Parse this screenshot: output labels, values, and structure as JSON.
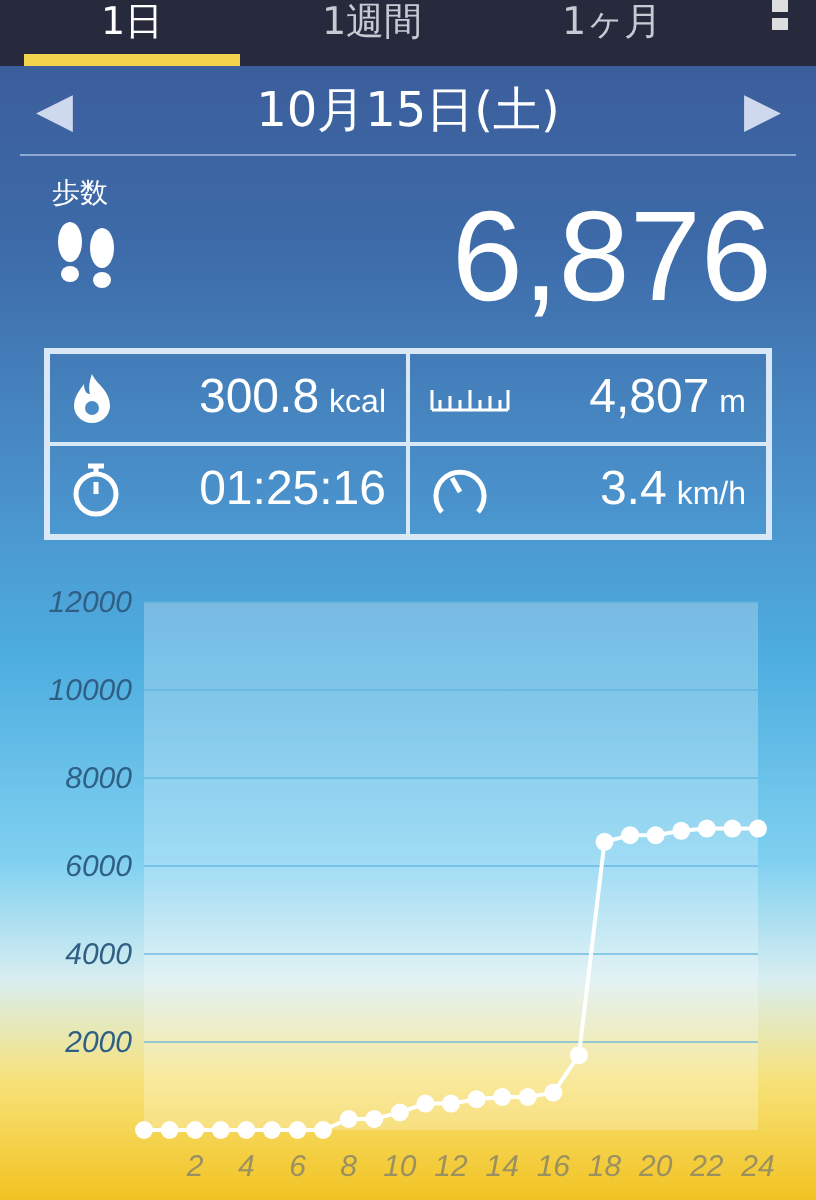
{
  "tabs": [
    {
      "label": "1日",
      "selected": true
    },
    {
      "label": "1週間",
      "selected": false
    },
    {
      "label": "1ヶ月",
      "selected": false
    }
  ],
  "date_nav": {
    "prev": "◀",
    "date": "10月15日(土)",
    "next": "▶"
  },
  "steps": {
    "label": "歩数",
    "value": "6,876"
  },
  "stats": [
    {
      "kind": "calories",
      "value": "300.8",
      "unit": "kcal"
    },
    {
      "kind": "distance",
      "value": "4,807",
      "unit": "m"
    },
    {
      "kind": "time",
      "value": "01:25:16"
    },
    {
      "kind": "speed",
      "value": "3.4",
      "unit": "km/h"
    }
  ],
  "chart": {
    "chart_data": {
      "type": "line",
      "x": [
        0,
        1,
        2,
        3,
        4,
        5,
        6,
        7,
        8,
        9,
        10,
        11,
        12,
        13,
        14,
        15,
        16,
        17,
        18,
        19,
        20,
        21,
        22,
        23,
        24
      ],
      "series": [
        {
          "color": "#ffffff",
          "marker": true,
          "values": [
            0,
            0,
            0,
            0,
            0,
            0,
            0,
            0,
            250,
            250,
            400,
            600,
            600,
            700,
            750,
            750,
            850,
            1700,
            6550,
            6700,
            6700,
            6800,
            6850,
            6850,
            6850
          ]
        }
      ],
      "grid": true,
      "xlim": [
        0,
        24
      ],
      "ylim": [
        0,
        12000
      ],
      "xticks": [
        2,
        4,
        6,
        8,
        10,
        12,
        14,
        16,
        18,
        20,
        22,
        24
      ],
      "yticks": [
        2000,
        4000,
        6000,
        8000,
        10000,
        12000
      ]
    }
  }
}
